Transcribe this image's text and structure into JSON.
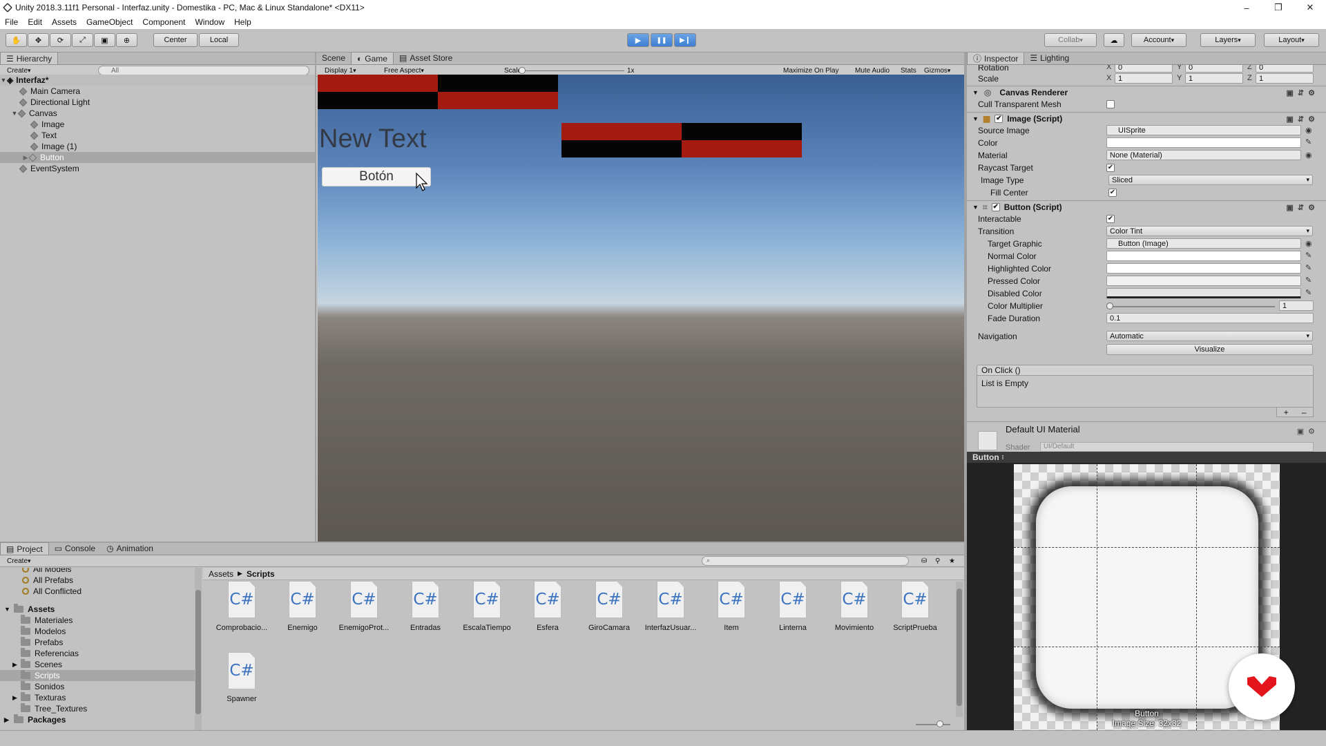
{
  "window": {
    "title": "Unity 2018.3.11f1 Personal - Interfaz.unity - Domestika - PC, Mac & Linux Standalone* <DX11>",
    "minimize": "–",
    "restore": "❐",
    "close": "✕"
  },
  "menu": [
    "File",
    "Edit",
    "Assets",
    "GameObject",
    "Component",
    "Window",
    "Help"
  ],
  "toolbar": {
    "tools": [
      "hand-tool",
      "move-tool",
      "rotate-tool",
      "scale-tool",
      "rect-tool",
      "transform-tool"
    ],
    "pivot": "Center",
    "space": "Local",
    "play": "▶",
    "pause": "❚❚",
    "step": "▶❙",
    "collab": "Collab",
    "cloud": "☁",
    "account": "Account",
    "layers": "Layers",
    "layout": "Layout"
  },
  "hierarchy": {
    "tab": "Hierarchy",
    "create": "Create",
    "search_placeholder": "All",
    "scene": "Interfaz*",
    "items": [
      {
        "label": "Main Camera"
      },
      {
        "label": "Directional Light"
      },
      {
        "label": "Canvas"
      },
      {
        "label": "Image"
      },
      {
        "label": "Text"
      },
      {
        "label": "Image (1)"
      },
      {
        "label": "Button"
      },
      {
        "label": "EventSystem"
      }
    ]
  },
  "views": {
    "tabs": [
      "Scene",
      "Game",
      "Asset Store"
    ],
    "display": "Display 1",
    "aspect": "Free Aspect",
    "scale_label": "Scale",
    "scale_value": "1x",
    "options": [
      "Maximize On Play",
      "Mute Audio",
      "Stats",
      "Gizmos"
    ]
  },
  "game": {
    "text": "New Text",
    "button_label": "Botón"
  },
  "inspector": {
    "tabs": [
      "Inspector",
      "Lighting"
    ],
    "transform": {
      "rotation_label": "Rotation",
      "rotation": [
        "0",
        "0",
        "0"
      ],
      "scale_label": "Scale",
      "scale": [
        "1",
        "1",
        "1"
      ],
      "axes": [
        "X",
        "Y",
        "Z"
      ]
    },
    "canvas_renderer": {
      "title": "Canvas Renderer",
      "cull_label": "Cull Transparent Mesh"
    },
    "image": {
      "title": "Image (Script)",
      "source_image_label": "Source Image",
      "source_image": "UISprite",
      "color_label": "Color",
      "material_label": "Material",
      "material": "None (Material)",
      "raycast_label": "Raycast Target",
      "image_type_label": "Image Type",
      "image_type": "Sliced",
      "fill_center_label": "Fill Center"
    },
    "button": {
      "title": "Button (Script)",
      "interactable_label": "Interactable",
      "transition_label": "Transition",
      "transition": "Color Tint",
      "target_graphic_label": "Target Graphic",
      "target_graphic": "Button (Image)",
      "normal_label": "Normal Color",
      "highlighted_label": "Highlighted Color",
      "pressed_label": "Pressed Color",
      "disabled_label": "Disabled Color",
      "multiplier_label": "Color Multiplier",
      "multiplier": "1",
      "fade_label": "Fade Duration",
      "fade": "0.1",
      "navigation_label": "Navigation",
      "navigation": "Automatic",
      "visualize": "Visualize",
      "onclick": "On Click ()",
      "list_empty": "List is Empty",
      "add": "+",
      "remove": "–"
    },
    "material_section": {
      "title": "Default UI Material",
      "shader_label": "Shader",
      "shader": "UI/Default"
    }
  },
  "preview": {
    "title": "Button",
    "name": "Button",
    "size": "Image Size: 32x32"
  },
  "project": {
    "tabs": [
      "Project",
      "Console",
      "Animation"
    ],
    "create": "Create",
    "favorites": [
      "All Models",
      "All Prefabs",
      "All Conflicted"
    ],
    "assets_root": "Assets",
    "folders": [
      "Materiales",
      "Modelos",
      "Prefabs",
      "Referencias",
      "Scenes",
      "Scripts",
      "Sonidos",
      "Texturas",
      "Tree_Textures"
    ],
    "packages": "Packages",
    "breadcrumb": [
      "Assets",
      "Scripts"
    ],
    "script_glyph": "C#",
    "scripts": [
      "Comprobacio...",
      "Enemigo",
      "EnemigoProt...",
      "Entradas",
      "EscalaTiempo",
      "Esfera",
      "GiroCamara",
      "InterfazUsuar...",
      "Item",
      "Linterna",
      "Movimiento",
      "ScriptPrueba",
      "Spawner"
    ]
  },
  "colors": {
    "accent_red": "#a31b10",
    "play_blue": "#3f7fd2",
    "domestika_red": "#e3141c"
  }
}
